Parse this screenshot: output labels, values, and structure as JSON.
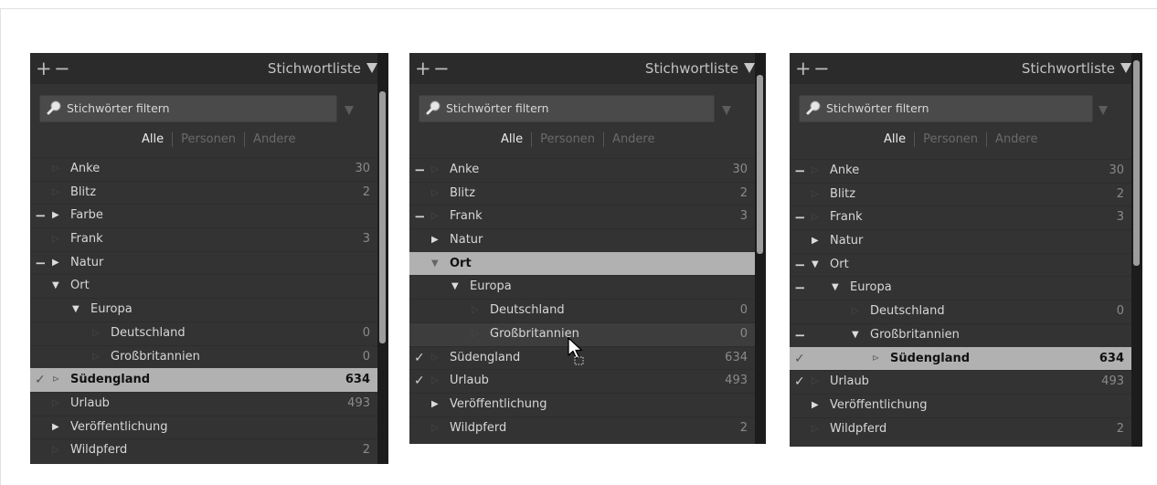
{
  "panels": [
    {
      "header": {
        "plus": "+",
        "minus": "−",
        "title": "Stichwortliste"
      },
      "filter": {
        "placeholder": "Stichwörter filtern"
      },
      "tabs": [
        {
          "label": "Alle",
          "active": true
        },
        {
          "label": "Personen",
          "active": false
        },
        {
          "label": "Andere",
          "active": false
        }
      ],
      "rows": [
        {
          "name": "Anke",
          "count": "30",
          "depth": 0,
          "arrow": "empty",
          "mark": ""
        },
        {
          "name": "Blitz",
          "count": "2",
          "depth": 0,
          "arrow": "empty",
          "mark": ""
        },
        {
          "name": "Farbe",
          "count": "",
          "depth": 0,
          "arrow": "collapsed",
          "mark": "minus"
        },
        {
          "name": "Frank",
          "count": "3",
          "depth": 0,
          "arrow": "empty",
          "mark": ""
        },
        {
          "name": "Natur",
          "count": "",
          "depth": 0,
          "arrow": "collapsed",
          "mark": "minus"
        },
        {
          "name": "Ort",
          "count": "",
          "depth": 0,
          "arrow": "expanded",
          "mark": ""
        },
        {
          "name": "Europa",
          "count": "",
          "depth": 1,
          "arrow": "expanded",
          "mark": ""
        },
        {
          "name": "Deutschland",
          "count": "0",
          "depth": 2,
          "arrow": "empty",
          "mark": ""
        },
        {
          "name": "Großbritannien",
          "count": "0",
          "depth": 2,
          "arrow": "empty",
          "mark": ""
        },
        {
          "name": "Südengland",
          "count": "634",
          "depth": 0,
          "arrow": "partial",
          "mark": "check-outline",
          "selected": true
        },
        {
          "name": "Urlaub",
          "count": "493",
          "depth": 0,
          "arrow": "empty",
          "mark": ""
        },
        {
          "name": "Veröffentlichung",
          "count": "",
          "depth": 0,
          "arrow": "collapsed",
          "mark": ""
        },
        {
          "name": "Wildpferd",
          "count": "2",
          "depth": 0,
          "arrow": "empty",
          "mark": ""
        }
      ]
    },
    {
      "header": {
        "plus": "+",
        "minus": "−",
        "title": "Stichwortliste"
      },
      "filter": {
        "placeholder": "Stichwörter filtern"
      },
      "tabs": [
        {
          "label": "Alle",
          "active": true
        },
        {
          "label": "Personen",
          "active": false
        },
        {
          "label": "Andere",
          "active": false
        }
      ],
      "rows": [
        {
          "name": "Anke",
          "count": "30",
          "depth": 0,
          "arrow": "empty",
          "mark": "minus"
        },
        {
          "name": "Blitz",
          "count": "2",
          "depth": 0,
          "arrow": "empty",
          "mark": ""
        },
        {
          "name": "Frank",
          "count": "3",
          "depth": 0,
          "arrow": "empty",
          "mark": "minus"
        },
        {
          "name": "Natur",
          "count": "",
          "depth": 0,
          "arrow": "collapsed",
          "mark": ""
        },
        {
          "name": "Ort",
          "count": "",
          "depth": 0,
          "arrow": "expanded",
          "mark": "",
          "selected": true
        },
        {
          "name": "Europa",
          "count": "",
          "depth": 1,
          "arrow": "expanded",
          "mark": ""
        },
        {
          "name": "Deutschland",
          "count": "0",
          "depth": 2,
          "arrow": "empty",
          "mark": ""
        },
        {
          "name": "Großbritannien",
          "count": "0",
          "depth": 2,
          "arrow": "empty",
          "mark": "",
          "hover": true
        },
        {
          "name": "Südengland",
          "count": "634",
          "depth": 0,
          "arrow": "empty",
          "mark": "check"
        },
        {
          "name": "Urlaub",
          "count": "493",
          "depth": 0,
          "arrow": "empty",
          "mark": "check"
        },
        {
          "name": "Veröffentlichung",
          "count": "",
          "depth": 0,
          "arrow": "collapsed",
          "mark": ""
        },
        {
          "name": "Wildpferd",
          "count": "2",
          "depth": 0,
          "arrow": "empty",
          "mark": ""
        }
      ]
    },
    {
      "header": {
        "plus": "+",
        "minus": "−",
        "title": "Stichwortliste"
      },
      "filter": {
        "placeholder": "Stichwörter filtern"
      },
      "tabs": [
        {
          "label": "Alle",
          "active": true
        },
        {
          "label": "Personen",
          "active": false
        },
        {
          "label": "Andere",
          "active": false
        }
      ],
      "rows": [
        {
          "name": "Anke",
          "count": "30",
          "depth": 0,
          "arrow": "empty",
          "mark": "minus"
        },
        {
          "name": "Blitz",
          "count": "2",
          "depth": 0,
          "arrow": "empty",
          "mark": ""
        },
        {
          "name": "Frank",
          "count": "3",
          "depth": 0,
          "arrow": "empty",
          "mark": "minus"
        },
        {
          "name": "Natur",
          "count": "",
          "depth": 0,
          "arrow": "collapsed",
          "mark": ""
        },
        {
          "name": "Ort",
          "count": "",
          "depth": 0,
          "arrow": "expanded",
          "mark": "minus"
        },
        {
          "name": "Europa",
          "count": "",
          "depth": 1,
          "arrow": "expanded",
          "mark": "minus"
        },
        {
          "name": "Deutschland",
          "count": "0",
          "depth": 2,
          "arrow": "empty",
          "mark": ""
        },
        {
          "name": "Großbritannien",
          "count": "",
          "depth": 2,
          "arrow": "expanded",
          "mark": "minus"
        },
        {
          "name": "Südengland",
          "count": "634",
          "depth": 3,
          "arrow": "partial",
          "mark": "check-outline",
          "selected": true
        },
        {
          "name": "Urlaub",
          "count": "493",
          "depth": 0,
          "arrow": "empty",
          "mark": "check"
        },
        {
          "name": "Veröffentlichung",
          "count": "",
          "depth": 0,
          "arrow": "collapsed",
          "mark": ""
        },
        {
          "name": "Wildpferd",
          "count": "2",
          "depth": 0,
          "arrow": "empty",
          "mark": ""
        }
      ]
    }
  ],
  "icons": {
    "plus": "plus-icon",
    "minus": "minus-icon",
    "panel_menu": "triangle-down-icon",
    "filter": "search-icon",
    "check": "check-icon",
    "cursor": "mouse-pointer-icon"
  },
  "colors": {
    "panel_bg": "#333333",
    "header_bg": "#2b2b2b",
    "selected_row": "#b1b1b1",
    "text": "#d7d7d7",
    "count": "#8a8a8a"
  }
}
